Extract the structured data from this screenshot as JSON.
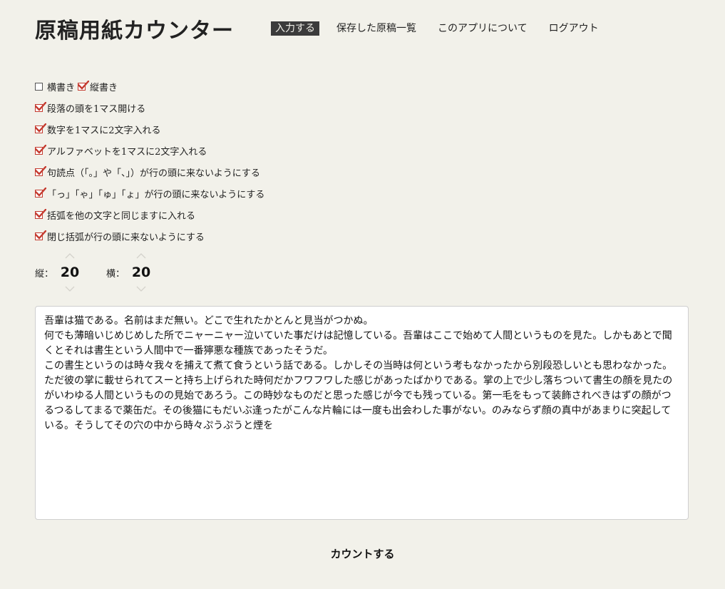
{
  "header": {
    "title": "原稿用紙カウンター",
    "nav": [
      {
        "label": "入力する",
        "active": true
      },
      {
        "label": "保存した原稿一覧",
        "active": false
      },
      {
        "label": "このアプリについて",
        "active": false
      },
      {
        "label": "ログアウト",
        "active": false
      }
    ]
  },
  "options": {
    "horizontal": {
      "label": "横書き",
      "checked": false
    },
    "vertical": {
      "label": "縦書き",
      "checked": true
    },
    "indent_paragraph": {
      "label": "段落の頭を1マス開ける",
      "checked": true
    },
    "two_digits_per_cell": {
      "label": "数字を1マスに2文字入れる",
      "checked": true
    },
    "two_alpha_per_cell": {
      "label": "アルファベットを1マスに2文字入れる",
      "checked": true
    },
    "punctuation_rule": {
      "label": "句読点（「。」や「、」）が行の頭に来ないようにする",
      "checked": true
    },
    "small_kana_rule": {
      "label": "「っ」「ゃ」「ゅ」「ょ」が行の頭に来ないようにする",
      "checked": true
    },
    "brackets_in_cell": {
      "label": "括弧を他の文字と同じますに入れる",
      "checked": true
    },
    "closing_bracket_rule": {
      "label": "閉じ括弧が行の頭に来ないようにする",
      "checked": true
    }
  },
  "grid": {
    "rows_label": "縦：",
    "rows_value": "20",
    "cols_label": "横：",
    "cols_value": "20"
  },
  "manuscript": {
    "text": "吾輩は猫である。名前はまだ無い。どこで生れたかとんと見当がつかぬ。\n何でも薄暗いじめじめした所でニャーニャー泣いていた事だけは記憶している。吾輩はここで始めて人間というものを見た。しかもあとで聞くとそれは書生という人間中で一番獰悪な種族であったそうだ。\nこの書生というのは時々我々を捕えて煮て食うという話である。しかしその当時は何という考もなかったから別段恐しいとも思わなかった。ただ彼の掌に載せられてスーと持ち上げられた時何だかフワフワした感じがあったばかりである。掌の上で少し落ちついて書生の顔を見たのがいわゆる人間というものの見始であろう。この時妙なものだと思った感じが今でも残っている。第一毛をもって装飾されべきはずの顔がつるつるしてまるで薬缶だ。その後猫にもだいぶ逢ったがこんな片輪には一度も出会わした事がない。のみならず顔の真中があまりに突起している。そうしてその穴の中から時々ぷうぷうと煙を"
  },
  "actions": {
    "count_label": "カウントする"
  },
  "colors": {
    "background": "#f2f1ea",
    "accent_check": "#c43a2f",
    "active_nav_bg": "#3b3b3b"
  }
}
